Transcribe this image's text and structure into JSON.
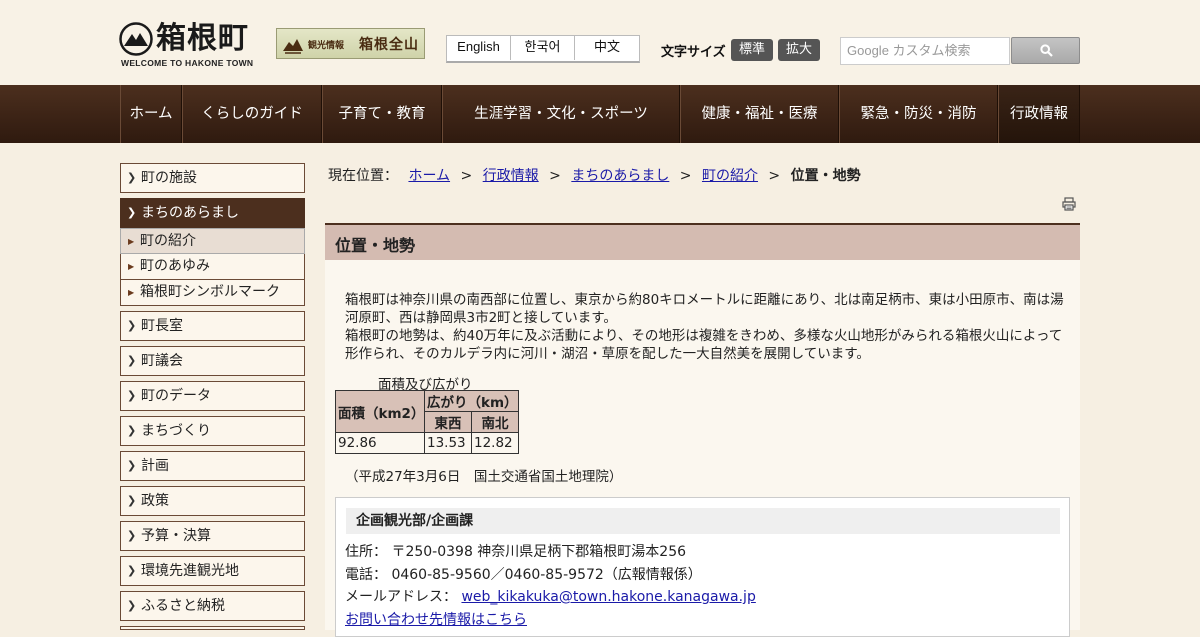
{
  "header": {
    "logo_text": "箱根町",
    "logo_sub": "WELCOME TO HAKONE TOWN",
    "tourism_small": "観光情報",
    "tourism_big": "箱根全山",
    "languages": [
      "English",
      "한국어",
      "中文"
    ],
    "fontsize_label": "文字サイズ",
    "fontsize_normal": "標準",
    "fontsize_large": "拡大",
    "search_placeholder": "Google カスタム検索"
  },
  "nav": {
    "items": [
      "ホーム",
      "くらしのガイド",
      "子育て・教育",
      "生涯学習・文化・スポーツ",
      "健康・福祉・医療",
      "緊急・防災・消防",
      "行政情報"
    ]
  },
  "sidebar": {
    "items": [
      "町の施設",
      "まちのあらまし",
      "町長室",
      "町議会",
      "町のデータ",
      "まちづくり",
      "計画",
      "政策",
      "予算・決算",
      "環境先進観光地",
      "ふるさと納税"
    ],
    "sub_items": [
      "町の紹介",
      "町のあゆみ",
      "箱根町シンボルマーク"
    ]
  },
  "breadcrumb": {
    "prefix": "現在位置：",
    "links": [
      "ホーム",
      "行政情報",
      "まちのあらまし",
      "町の紹介"
    ],
    "sep": ">",
    "current": "位置・地勢"
  },
  "main": {
    "title": "位置・地勢",
    "para1": "箱根町は神奈川県の南西部に位置し、東京から約80キロメートルに距離にあり、北は南足柄市、東は小田原市、南は湯河原町、西は静岡県3市2町と接しています。",
    "para2": "箱根町の地勢は、約40万年に及ぶ活動により、その地形は複雑をきわめ、多様な火山地形がみられる箱根火山によって形作られ、そのカルデラ内に河川・湖沼・草原を配した一大自然美を展開しています。",
    "table_caption": "面積及び広がり",
    "table": {
      "area_header": "面積（km2）",
      "spread_header": "広がり（km）",
      "ew_header": "東西",
      "ns_header": "南北",
      "area": "92.86",
      "ew": "13.53",
      "ns": "12.82"
    },
    "note": "（平成27年3月6日　国土交通省国土地理院）"
  },
  "contact": {
    "department": "企画観光部/企画課",
    "address_label": "住所：",
    "address": "〒250-0398 神奈川県足柄下郡箱根町湯本256",
    "phone_label": "電話：",
    "phone": "0460-85-9560／0460-85-9572（広報情報係）",
    "email_label": "メールアドレス：",
    "email": "web_kikakuka@town.hakone.kanagawa.jp",
    "inquiry_link": "お問い合わせ先情報はこちら"
  },
  "colors": {
    "nav_brown": "#4c2f1e",
    "title_bar": "#d4bbb1",
    "link": "#1a1aa8"
  }
}
